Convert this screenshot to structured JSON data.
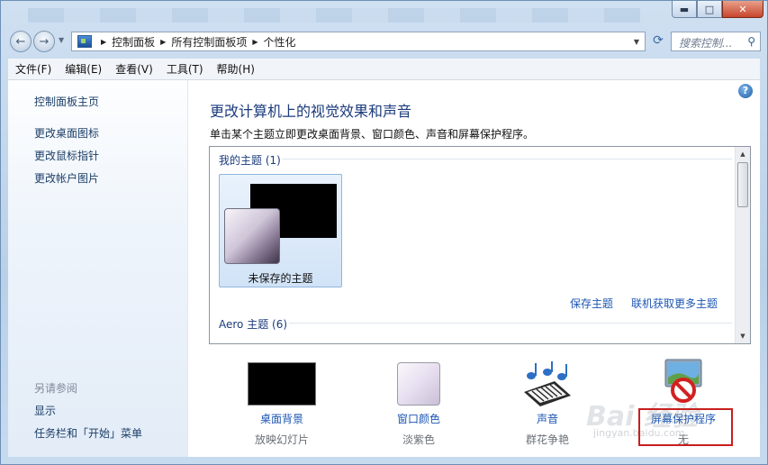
{
  "window": {
    "controls": {
      "minimize": "▬",
      "maximize": "□",
      "close": "✕"
    }
  },
  "nav": {
    "breadcrumb": [
      "控制面板",
      "所有控制面板项",
      "个性化"
    ],
    "search_placeholder": "搜索控制...",
    "back_icon": "←",
    "forward_icon": "→",
    "refresh_icon": "⟳",
    "search_icon": "⚲"
  },
  "menubar": {
    "items": [
      "文件(F)",
      "编辑(E)",
      "查看(V)",
      "工具(T)",
      "帮助(H)"
    ]
  },
  "sidebar": {
    "links": [
      "控制面板主页",
      "更改桌面图标",
      "更改鼠标指针",
      "更改帐户图片"
    ],
    "see_also_heading": "另请参阅",
    "see_also": [
      "显示",
      "任务栏和「开始」菜单"
    ]
  },
  "main": {
    "help_icon": "?",
    "title": "更改计算机上的视觉效果和声音",
    "subtitle": "单击某个主题立即更改桌面背景、窗口颜色、声音和屏幕保护程序。",
    "my_themes_heading": "我的主题 (1)",
    "aero_heading": "Aero 主题 (6)",
    "unsaved_theme": "未保存的主题",
    "save_theme": "保存主题",
    "get_more_themes": "联机获取更多主题"
  },
  "settings": [
    {
      "label": "桌面背景",
      "value": "放映幻灯片"
    },
    {
      "label": "窗口颜色",
      "value": "淡紫色"
    },
    {
      "label": "声音",
      "value": "群花争艳"
    },
    {
      "label": "屏幕保护程序",
      "value": "无"
    }
  ],
  "watermark": {
    "text": "Bai 经验",
    "url": "jingyan.baidu.com"
  },
  "colors": {
    "link": "#1c56b3",
    "heading": "#1b3b7d",
    "highlight_box": "#c81e1e"
  }
}
